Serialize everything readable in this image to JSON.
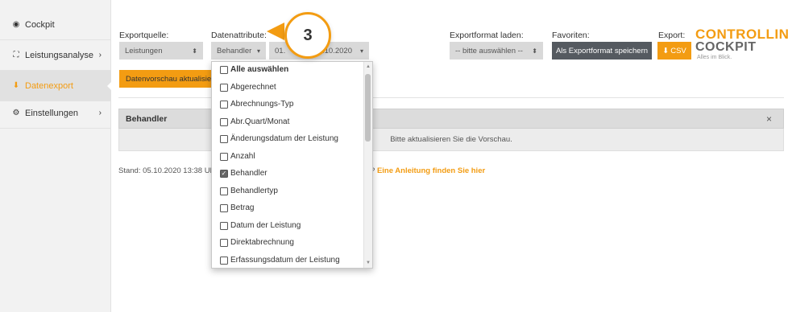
{
  "sidebar": {
    "items": [
      {
        "icon": "dashboard-icon",
        "glyph": "◉",
        "label": "Cockpit",
        "chevron": ""
      },
      {
        "icon": "chart-line-icon",
        "glyph": "⛶",
        "label": "Leistungsanalyse",
        "chevron": "›"
      },
      {
        "icon": "download-icon",
        "glyph": "⬇",
        "label": "Datenexport",
        "chevron": ""
      },
      {
        "icon": "cogs-icon",
        "glyph": "⚙",
        "label": "Einstellungen",
        "chevron": "›"
      }
    ]
  },
  "toolbar": {
    "export_source_label": "Exportquelle:",
    "export_source_value": "Leistungen",
    "data_attributes_label": "Datenattribute:",
    "data_attributes_value": "Behandler",
    "date_value_left": "01.",
    "date_value_right": ".10.2020",
    "load_format_label": "Exportformat laden:",
    "load_format_value": "-- bitte auswählen --",
    "favorites_label": "Favoriten:",
    "save_format_button": "Als Exportformat speichern",
    "export_label": "Export:",
    "csv_button": "CSV",
    "preview_button": "Datenvorschau aktualisieren"
  },
  "logo": {
    "line1": "CONTROLLING",
    "line2": "COCKPIT",
    "tagline": "Alles im Blick."
  },
  "panel": {
    "header": "Behandler",
    "close": "×",
    "message": "Bitte aktualisieren Sie die Vorschau."
  },
  "status": {
    "stand": "Stand: 05.10.2020 13:38 Uh",
    "help_prefix": "? ",
    "help_link": "Eine Anleitung finden Sie hier"
  },
  "dropdown": {
    "options": [
      {
        "label": "Alle auswählen",
        "checked": false,
        "bold": true
      },
      {
        "label": "Abgerechnet",
        "checked": false,
        "bold": false
      },
      {
        "label": "Abrechnungs-Typ",
        "checked": false,
        "bold": false
      },
      {
        "label": "Abr.Quart/Monat",
        "checked": false,
        "bold": false
      },
      {
        "label": "Änderungsdatum der Leistung",
        "checked": false,
        "bold": false
      },
      {
        "label": "Anzahl",
        "checked": false,
        "bold": false
      },
      {
        "label": "Behandler",
        "checked": true,
        "bold": false
      },
      {
        "label": "Behandlertyp",
        "checked": false,
        "bold": false
      },
      {
        "label": "Betrag",
        "checked": false,
        "bold": false
      },
      {
        "label": "Datum der Leistung",
        "checked": false,
        "bold": false
      },
      {
        "label": "Direktabrechnung",
        "checked": false,
        "bold": false
      },
      {
        "label": "Erfassungsdatum der Leistung",
        "checked": false,
        "bold": false
      }
    ]
  },
  "callout": {
    "number": "3"
  },
  "colors": {
    "accent": "#f39c12",
    "dark_button": "#555a60"
  }
}
